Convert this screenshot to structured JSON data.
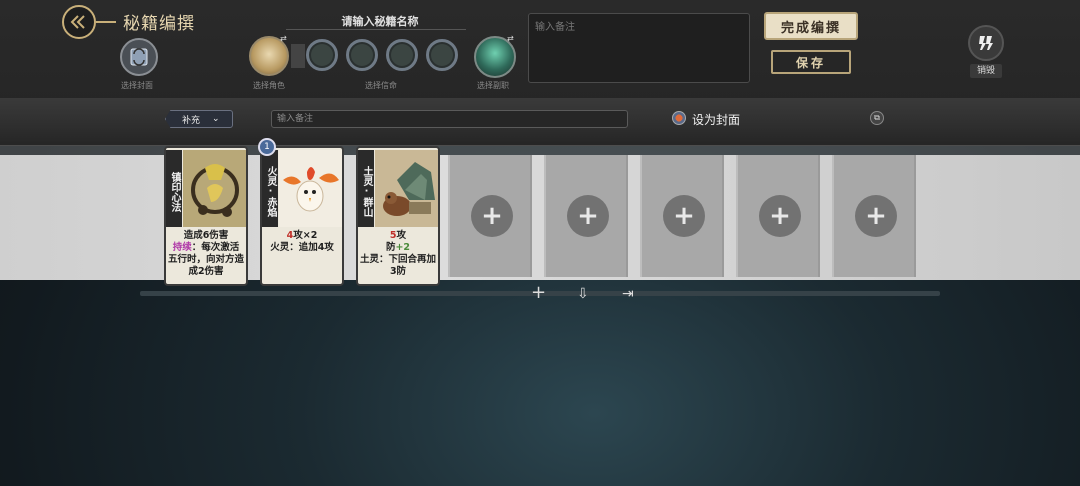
{
  "header": {
    "title": "秘籍编撰",
    "cover_label": "选择封面",
    "name_prompt": "请输入秘籍名称",
    "character_label": "选择角色",
    "life_label": "选择信命",
    "guide_label": "选择副职",
    "note_placeholder": "输入备注",
    "finish_label": "完成编撰",
    "save_label": "保存",
    "destroy_label": "销毁",
    "swap_mark": "⇄"
  },
  "toolbar": {
    "filter_label": "补充",
    "search_placeholder": "输入备注",
    "set_cover_label": "设为封面"
  },
  "cards": [
    {
      "name": "镇印心法",
      "desc_lines": [
        "造成6伤害"
      ],
      "keyword": "持续",
      "keyword_rest": "：每次激活五行时，向对方造成2伤害"
    },
    {
      "name": "火灵·赤焰",
      "badge": "1",
      "num": "4",
      "line1_rest": "攻×2",
      "line2": "火灵：追加4攻"
    },
    {
      "name": "土灵·群山",
      "num": "5",
      "line1_rest": "攻",
      "line2_prefix": "防",
      "line2_num": "+2",
      "line3": "土灵：下回合再加3防"
    }
  ],
  "empty_slots": [
    {
      "symbol": "+"
    },
    {
      "symbol": "+"
    },
    {
      "symbol": "+"
    },
    {
      "symbol": "+"
    },
    {
      "symbol": "+"
    }
  ],
  "bottom_tools": {
    "add": "+",
    "import": "⇩",
    "export": "⇥"
  }
}
